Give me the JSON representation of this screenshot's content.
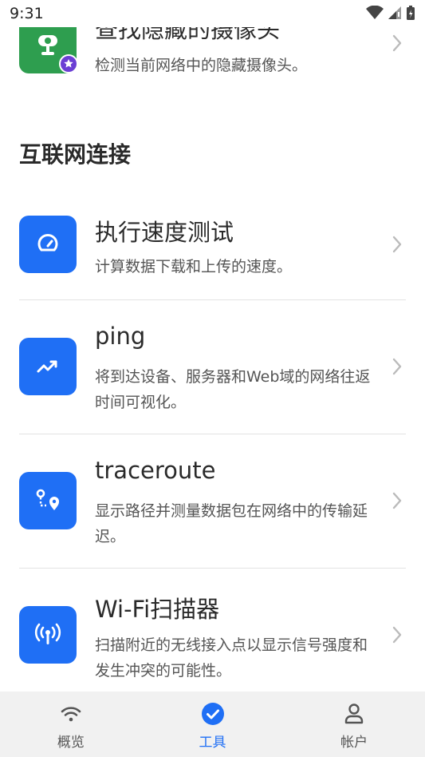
{
  "status_bar": {
    "time": "9:31"
  },
  "top_item": {
    "title": "查找隐藏的摄像头",
    "desc": "检测当前网络中的隐藏摄像头。",
    "icon": "camera-icon",
    "color": "#2e9e4f",
    "badge_icon": "star-badge-icon"
  },
  "section": {
    "title": "互联网连接"
  },
  "tools": [
    {
      "title": "执行速度测试",
      "desc": "计算数据下载和上传的速度。",
      "icon": "speedometer-icon"
    },
    {
      "title": "ping",
      "desc": "将到达设备、服务器和Web域的网络往返时间可视化。",
      "icon": "trend-up-icon"
    },
    {
      "title": "traceroute",
      "desc": "显示路径并测量数据包在网络中的传输延迟。",
      "icon": "route-pin-icon"
    },
    {
      "title": "Wi-Fi扫描器",
      "desc": "扫描附近的无线接入点以显示信号强度和发生冲突的可能性。",
      "icon": "antenna-signal-icon"
    }
  ],
  "bottom_nav": [
    {
      "label": "概览",
      "icon": "wifi-icon",
      "active": false
    },
    {
      "label": "工具",
      "icon": "check-circle-icon",
      "active": true
    },
    {
      "label": "帐户",
      "icon": "account-icon",
      "active": false
    }
  ],
  "colors": {
    "accent": "#1f6ff5",
    "green": "#2e9e4f",
    "divider": "#e3e3e3"
  }
}
